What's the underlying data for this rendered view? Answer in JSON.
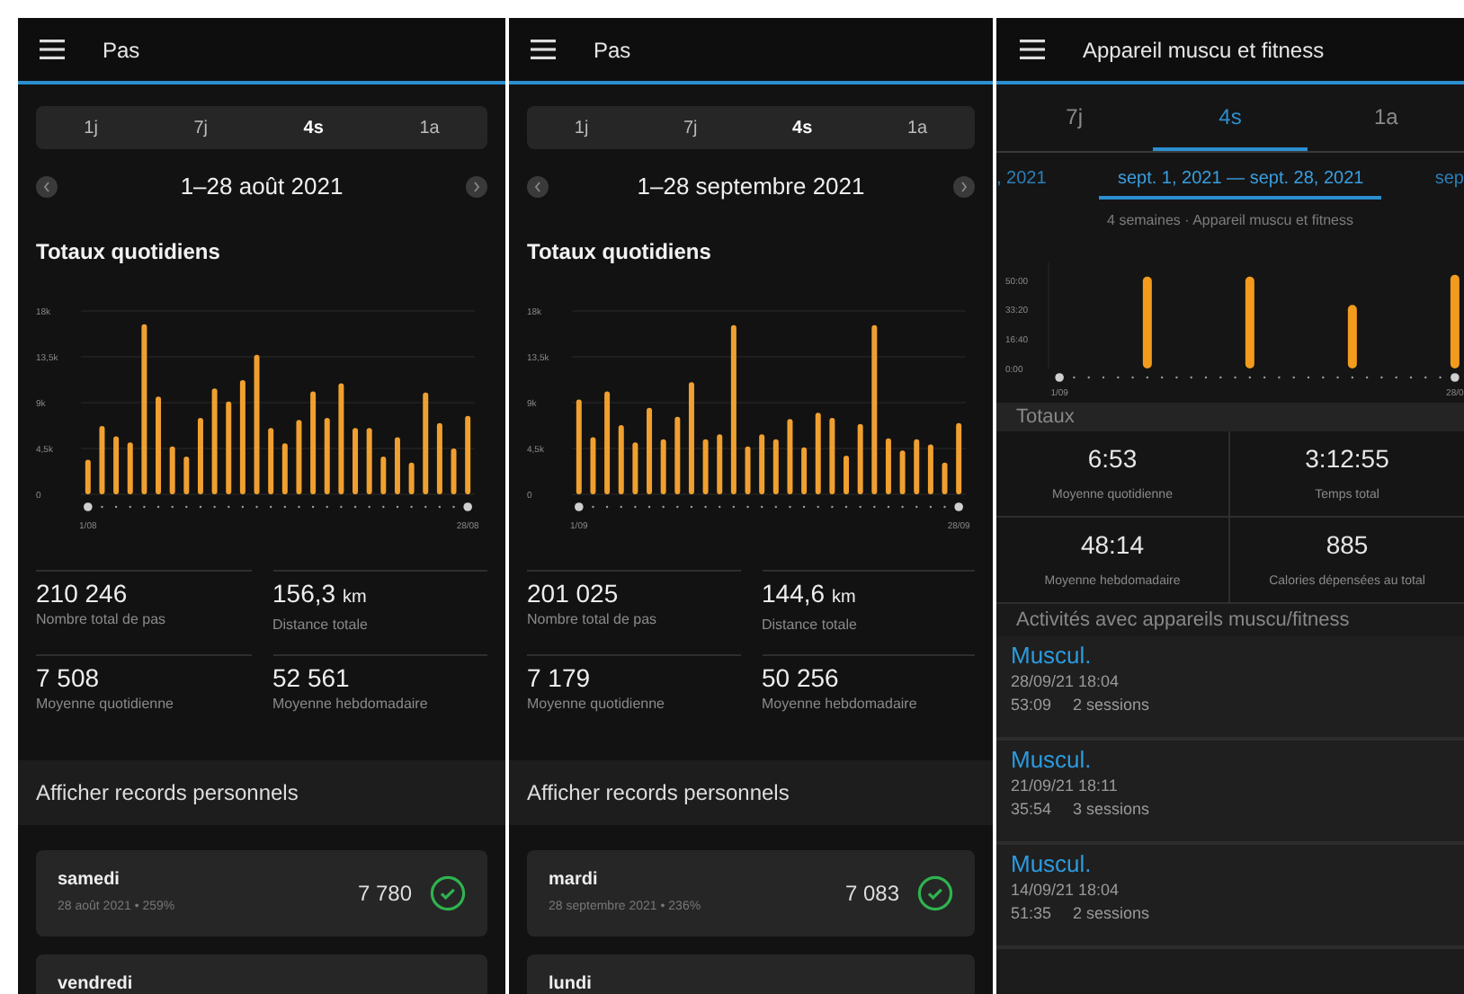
{
  "panels": [
    {
      "kind": "steps",
      "title": "Pas",
      "tabs": [
        {
          "label": "1j",
          "selected": false
        },
        {
          "label": "7j",
          "selected": false
        },
        {
          "label": "4s",
          "selected": true
        },
        {
          "label": "1a",
          "selected": false
        }
      ],
      "period": "1–28 août 2021",
      "section_title": "Totaux quotidiens",
      "chart_data": {
        "type": "bar",
        "categories": [
          "1/08",
          null,
          null,
          null,
          null,
          null,
          null,
          null,
          null,
          null,
          null,
          null,
          null,
          null,
          null,
          null,
          null,
          null,
          null,
          null,
          null,
          null,
          null,
          null,
          null,
          null,
          null,
          "28/08"
        ],
        "series": [
          {
            "color": "#f0a030",
            "values": [
              3400,
              6700,
              5700,
              5100,
              16700,
              9600,
              4700,
              3700,
              7500,
              10400,
              9100,
              11200,
              13700,
              6500,
              5000,
              7300,
              10100,
              7500,
              10900,
              6500,
              6500,
              3700,
              5600,
              3100,
              10000,
              7000,
              4500,
              7700
            ]
          }
        ],
        "ylim": [
          0,
          18000
        ],
        "grid": true,
        "yticks": [
          {
            "value": 0,
            "label": "0"
          },
          {
            "value": 4500,
            "label": "4,5k"
          },
          {
            "value": 9000,
            "label": "9k"
          },
          {
            "value": 13500,
            "label": "13,5k"
          },
          {
            "value": 18000,
            "label": "18k"
          }
        ]
      },
      "stats": [
        {
          "value": "210 246",
          "label": "Nombre total de pas"
        },
        {
          "value": "156,3",
          "unit": "km",
          "label": "Distance totale"
        },
        {
          "value": "7 508",
          "label": "Moyenne quotidienne"
        },
        {
          "value": "52 561",
          "label": "Moyenne hebdomadaire"
        }
      ],
      "records_link": "Afficher records personnels",
      "records": [
        {
          "day": "samedi",
          "detail": "28 août 2021 • 259%",
          "value": "7 780"
        },
        {
          "day": "vendredi"
        }
      ]
    },
    {
      "kind": "steps",
      "title": "Pas",
      "tabs": [
        {
          "label": "1j",
          "selected": false
        },
        {
          "label": "7j",
          "selected": false
        },
        {
          "label": "4s",
          "selected": true
        },
        {
          "label": "1a",
          "selected": false
        }
      ],
      "period": "1–28 septembre 2021",
      "section_title": "Totaux quotidiens",
      "chart_data": {
        "type": "bar",
        "categories": [
          "1/09",
          null,
          null,
          null,
          null,
          null,
          null,
          null,
          null,
          null,
          null,
          null,
          null,
          null,
          null,
          null,
          null,
          null,
          null,
          null,
          null,
          null,
          null,
          null,
          null,
          null,
          null,
          "28/09"
        ],
        "series": [
          {
            "color": "#f0a030",
            "values": [
              9300,
              5600,
              10100,
              6800,
              5100,
              8500,
              5400,
              7600,
              11000,
              5400,
              5900,
              16600,
              4700,
              5900,
              5400,
              7400,
              4600,
              8000,
              7500,
              3800,
              6900,
              16600,
              5500,
              4300,
              5400,
              4900,
              3100,
              7000
            ]
          }
        ],
        "ylim": [
          0,
          18000
        ],
        "grid": true,
        "yticks": [
          {
            "value": 0,
            "label": "0"
          },
          {
            "value": 4500,
            "label": "4,5k"
          },
          {
            "value": 9000,
            "label": "9k"
          },
          {
            "value": 13500,
            "label": "13,5k"
          },
          {
            "value": 18000,
            "label": "18k"
          }
        ]
      },
      "stats": [
        {
          "value": "201 025",
          "label": "Nombre total de pas"
        },
        {
          "value": "144,6",
          "unit": "km",
          "label": "Distance totale"
        },
        {
          "value": "7 179",
          "label": "Moyenne quotidienne"
        },
        {
          "value": "50 256",
          "label": "Moyenne hebdomadaire"
        }
      ],
      "records_link": "Afficher records personnels",
      "records": [
        {
          "day": "mardi",
          "detail": "28 septembre 2021 • 236%",
          "value": "7 083"
        },
        {
          "day": "lundi"
        }
      ]
    },
    {
      "kind": "fitness",
      "title": "Appareil muscu et fitness",
      "tabs": [
        {
          "label": "7j",
          "selected": false
        },
        {
          "label": "4s",
          "selected": true
        },
        {
          "label": "1a",
          "selected": false
        }
      ],
      "periods": [
        {
          "label": ", 2021",
          "selected": false
        },
        {
          "label": "sept. 1, 2021 — sept. 28, 2021",
          "selected": true
        },
        {
          "label": "sep",
          "selected": false
        }
      ],
      "subtitle": "4 semaines · Appareil muscu et fitness",
      "chart_data": {
        "type": "bar",
        "categories": [
          "1/09",
          null,
          null,
          null,
          null,
          null,
          null,
          null,
          null,
          null,
          null,
          null,
          null,
          null,
          null,
          null,
          null,
          null,
          null,
          null,
          null,
          null,
          null,
          null,
          null,
          null,
          null,
          "28/0"
        ],
        "series": [
          {
            "color": "#f29b1d",
            "values": [
              null,
              null,
              null,
              null,
              null,
              null,
              52,
              null,
              null,
              null,
              null,
              null,
              null,
              52,
              null,
              null,
              null,
              null,
              null,
              null,
              36,
              null,
              null,
              null,
              null,
              null,
              null,
              53
            ]
          }
        ],
        "ylim": [
          0,
          60
        ],
        "yticks": [
          {
            "value": 0,
            "label": "0:00"
          },
          {
            "value": 16.67,
            "label": "16:40"
          },
          {
            "value": 33.33,
            "label": "33:20"
          },
          {
            "value": 50,
            "label": "50:00"
          }
        ]
      },
      "totals_title": "Totaux",
      "totals": [
        {
          "value": "6:53",
          "label": "Moyenne quotidienne"
        },
        {
          "value": "3:12:55",
          "label": "Temps total"
        },
        {
          "value": "48:14",
          "label": "Moyenne hebdomadaire"
        },
        {
          "value": "885",
          "label": "Calories dépensées au total"
        }
      ],
      "activities_title": "Activités avec appareils muscu/fitness",
      "activities": [
        {
          "name": "Muscul.",
          "date": "28/09/21 18:04",
          "duration": "53:09",
          "sessions": "2 sessions"
        },
        {
          "name": "Muscul.",
          "date": "21/09/21 18:11",
          "duration": "35:54",
          "sessions": "3 sessions"
        },
        {
          "name": "Muscul.",
          "date": "14/09/21 18:04",
          "duration": "51:35",
          "sessions": "2 sessions"
        }
      ]
    }
  ]
}
